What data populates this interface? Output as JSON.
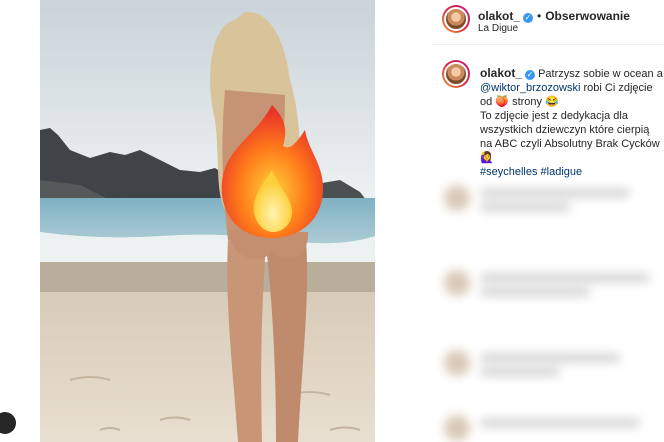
{
  "post": {
    "username": "olakot_",
    "follow_label": "Obserwowanie",
    "location": "La Digue",
    "separator": "•"
  },
  "caption": {
    "username": "olakot_",
    "line1": "Patrzysz sobie w ocean a",
    "mention": "@wiktor_brzozowski",
    "line2": " robi Ci zdjęcie od",
    "line3": "🍑 strony 😂",
    "line4": "To zdjęcie jest z dedykacja dla wszystkich dziewczyn które cierpią na ABC czyli Absolutny Brak Cycków 🙋‍♀️",
    "hashtags": "#seychelles #ladigue"
  },
  "icons": {
    "verified": "verified-badge-icon",
    "overlay": "fire-emoji-icon"
  },
  "colors": {
    "link": "#00376b",
    "verified": "#3897f0",
    "ring_start": "#f09433",
    "ring_end": "#bc1888"
  }
}
